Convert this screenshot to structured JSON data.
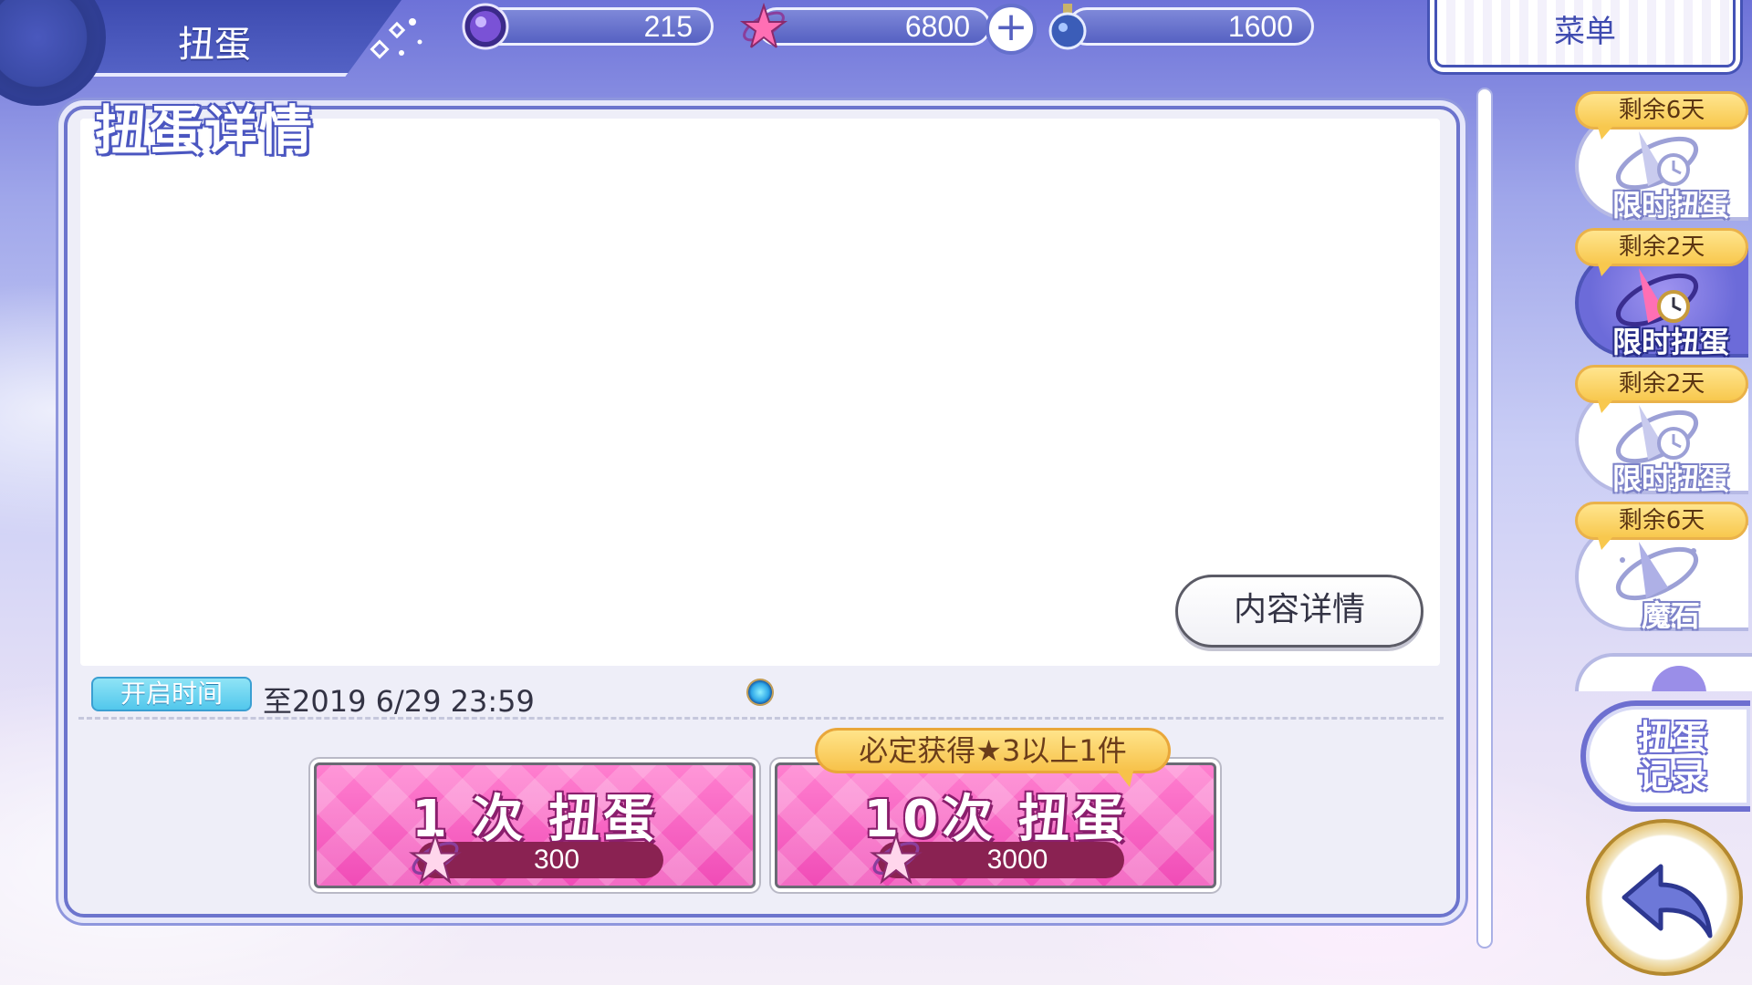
{
  "header": {
    "title": "扭蛋",
    "menu_label": "菜单"
  },
  "currencies": {
    "gem": {
      "icon": "purple-orb-icon",
      "value": "215"
    },
    "jewel": {
      "icon": "star-jewel-icon",
      "value": "6800"
    },
    "potion": {
      "icon": "potion-bottle-icon",
      "value": "1600"
    },
    "plus_label": "+"
  },
  "panel": {
    "title": "扭蛋详情",
    "details_button": "内容详情",
    "open_label": "开启时间",
    "open_time": "至2019 6/29 23:59"
  },
  "pulls": {
    "single": {
      "label": "1 次 扭蛋",
      "cost": "300"
    },
    "ten": {
      "label": "10次 扭蛋",
      "cost": "3000",
      "guarantee": "必定获得★3以上1件"
    }
  },
  "tabs": [
    {
      "badge": "剩余6天",
      "label": "限时扭蛋",
      "active": false
    },
    {
      "badge": "剩余2天",
      "label": "限时扭蛋",
      "active": true
    },
    {
      "badge": "剩余2天",
      "label": "限时扭蛋",
      "active": false
    },
    {
      "badge": "剩余6天",
      "label": "魔石",
      "active": false
    }
  ],
  "side": {
    "history_label": "扭蛋\n记录",
    "back_icon": "back-arrow-icon"
  },
  "colors": {
    "accent_blue": "#4553b6",
    "pull_pink": "#f04cb7",
    "badge_gold": "#f8c84e",
    "label_cyan": "#52c7ec"
  }
}
